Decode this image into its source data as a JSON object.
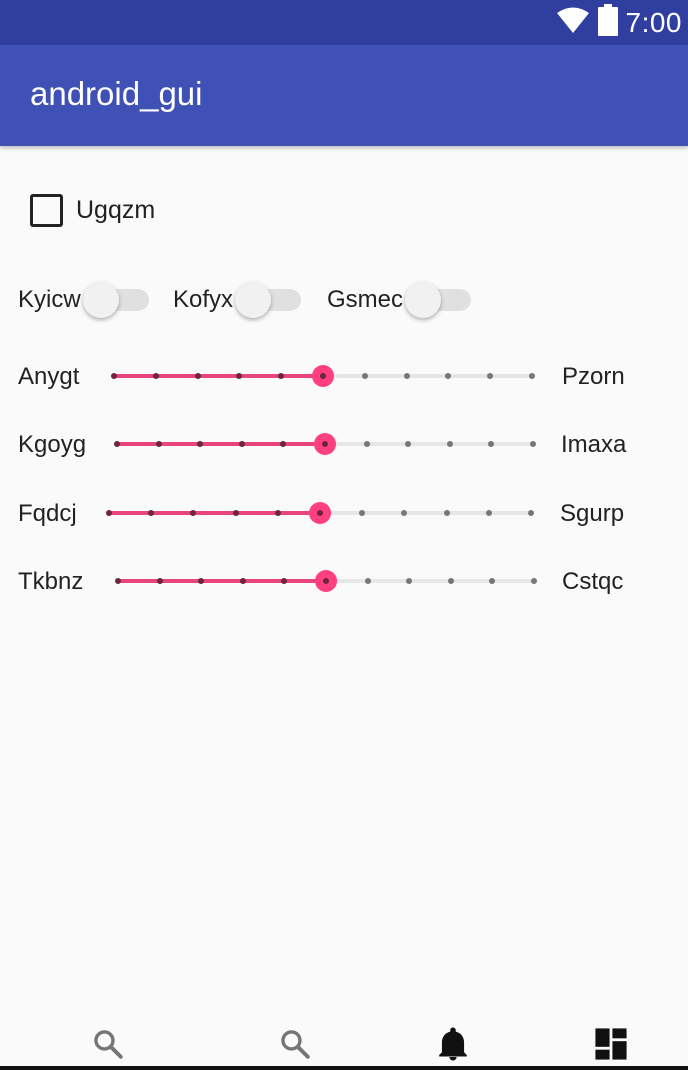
{
  "status_bar": {
    "time": "7:00",
    "icons": [
      "wifi-icon",
      "battery-icon"
    ],
    "color": "#303f9f"
  },
  "app_bar": {
    "title": "android_gui",
    "color": "#3f51b5"
  },
  "checkbox": {
    "label": "Ugqzm",
    "checked": false
  },
  "switches": [
    {
      "label": "Kyicw",
      "on": false
    },
    {
      "label": "Kofyx",
      "on": false
    },
    {
      "label": "Gsmec",
      "on": false
    }
  ],
  "sliders": [
    {
      "left_label": "Anygt",
      "right_label": "Pzorn",
      "value": 5,
      "max": 10
    },
    {
      "left_label": "Kgoyg",
      "right_label": "Imaxa",
      "value": 5,
      "max": 10
    },
    {
      "left_label": "Fqdcj",
      "right_label": "Sgurp",
      "value": 5,
      "max": 10
    },
    {
      "left_label": "Tkbnz",
      "right_label": "Cstqc",
      "value": 5,
      "max": 10
    }
  ],
  "accent_color": "#ff4081",
  "bottom_nav": [
    {
      "icon": "search-icon"
    },
    {
      "icon": "search-icon"
    },
    {
      "icon": "bell-icon"
    },
    {
      "icon": "dashboard-icon"
    }
  ]
}
